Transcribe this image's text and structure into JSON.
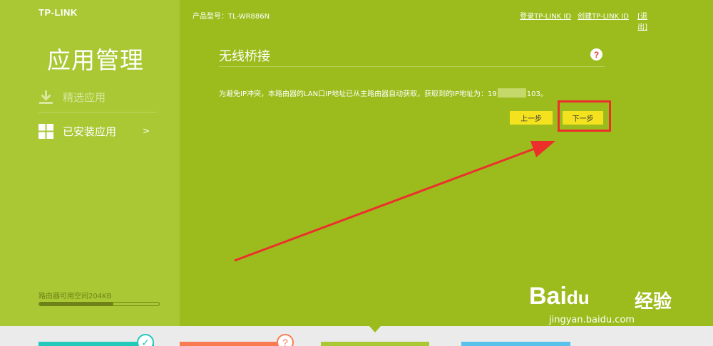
{
  "brand": {
    "logo": "TP-LINK"
  },
  "sidebar": {
    "title": "应用管理",
    "items": [
      {
        "label": "精选应用",
        "icon": "download-icon"
      },
      {
        "label": "已安装应用",
        "icon": "grid-icon",
        "arrow": ">"
      }
    ],
    "storage_label": "路由器可用空间204KB",
    "storage_fraction": 0.62
  },
  "header": {
    "model_label": "产品型号：TL-WR886N",
    "login_link": "登录TP-LINK ID",
    "create_link": "创建TP-LINK ID",
    "logout_link": "[退出]"
  },
  "main": {
    "title": "无线桥接",
    "help_icon_text": "?",
    "message_prefix": "为避免IP冲突，本路由器的LAN口IP地址已从主路由器自动获取，获取到的IP地址为：19",
    "message_suffix": "103。",
    "prev_button": "上一步",
    "next_button": "下一步"
  },
  "bottom": {
    "check_badge": "✓",
    "question_badge": "?"
  },
  "watermark": {
    "brand": "Bai",
    "paw": "du",
    "name": "经验",
    "url": "jingyan.baidu.com"
  },
  "colors": {
    "background": "#9bbc1c",
    "sidebar": "#a9c834",
    "button": "#f4e21f",
    "highlight": "#ed2f2c",
    "tab_teal": "#22c9ba",
    "tab_orange": "#fa7b52",
    "tab_green": "#a9c834",
    "tab_blue": "#57c2ea"
  }
}
